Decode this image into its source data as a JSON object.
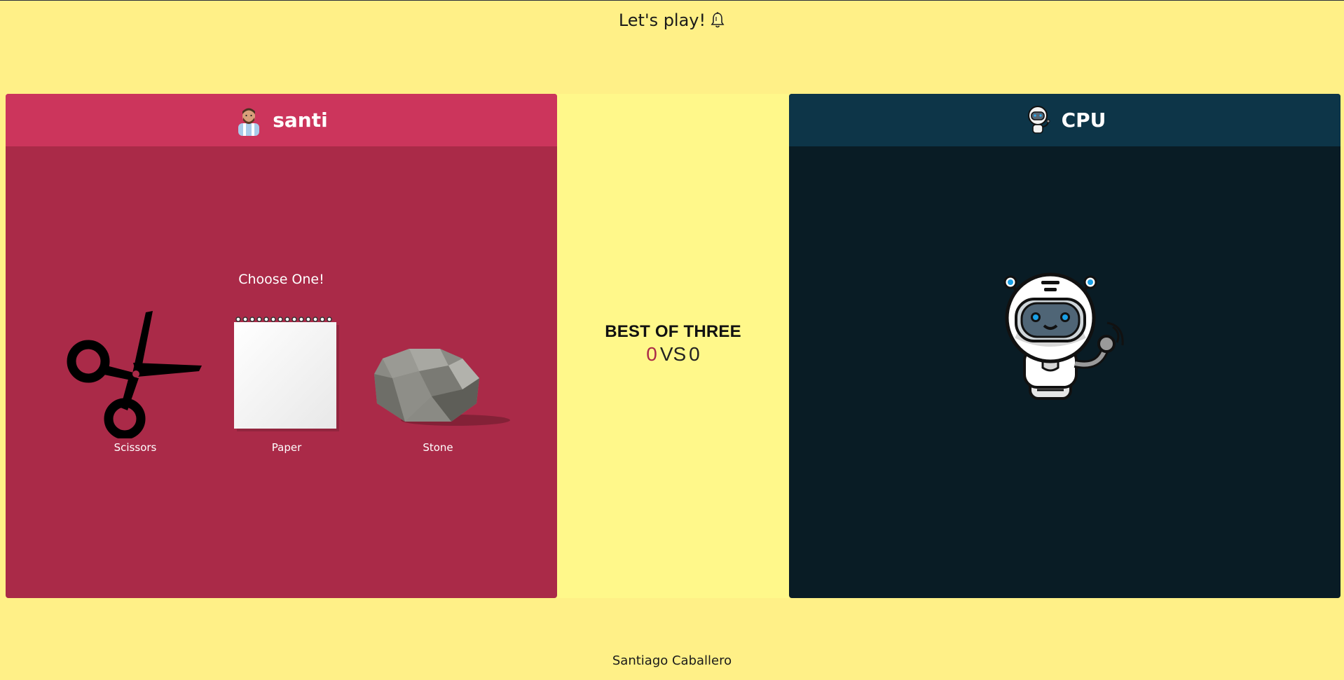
{
  "header": {
    "title": "Let's play!",
    "icon": "bell-icon"
  },
  "player": {
    "name": "santi",
    "avatar_icon": "player-avatar-icon",
    "prompt": "Choose One!",
    "choices": [
      {
        "label": "Scissors",
        "icon": "scissors-icon"
      },
      {
        "label": "Paper",
        "icon": "paper-icon"
      },
      {
        "label": "Stone",
        "icon": "stone-icon"
      }
    ],
    "color": "#aa2a48",
    "header_color": "#cc355c"
  },
  "cpu": {
    "name": "CPU",
    "avatar_icon": "robot-avatar-icon",
    "image_icon": "robot-icon",
    "color": "#091c25",
    "header_color": "#0d3548"
  },
  "scoreboard": {
    "title": "BEST OF THREE",
    "player_score": "0",
    "vs_label": "VS",
    "cpu_score": "0"
  },
  "footer": {
    "author": "Santiago Caballero"
  },
  "colors": {
    "background": "#fff087",
    "middle": "#fff88a"
  }
}
